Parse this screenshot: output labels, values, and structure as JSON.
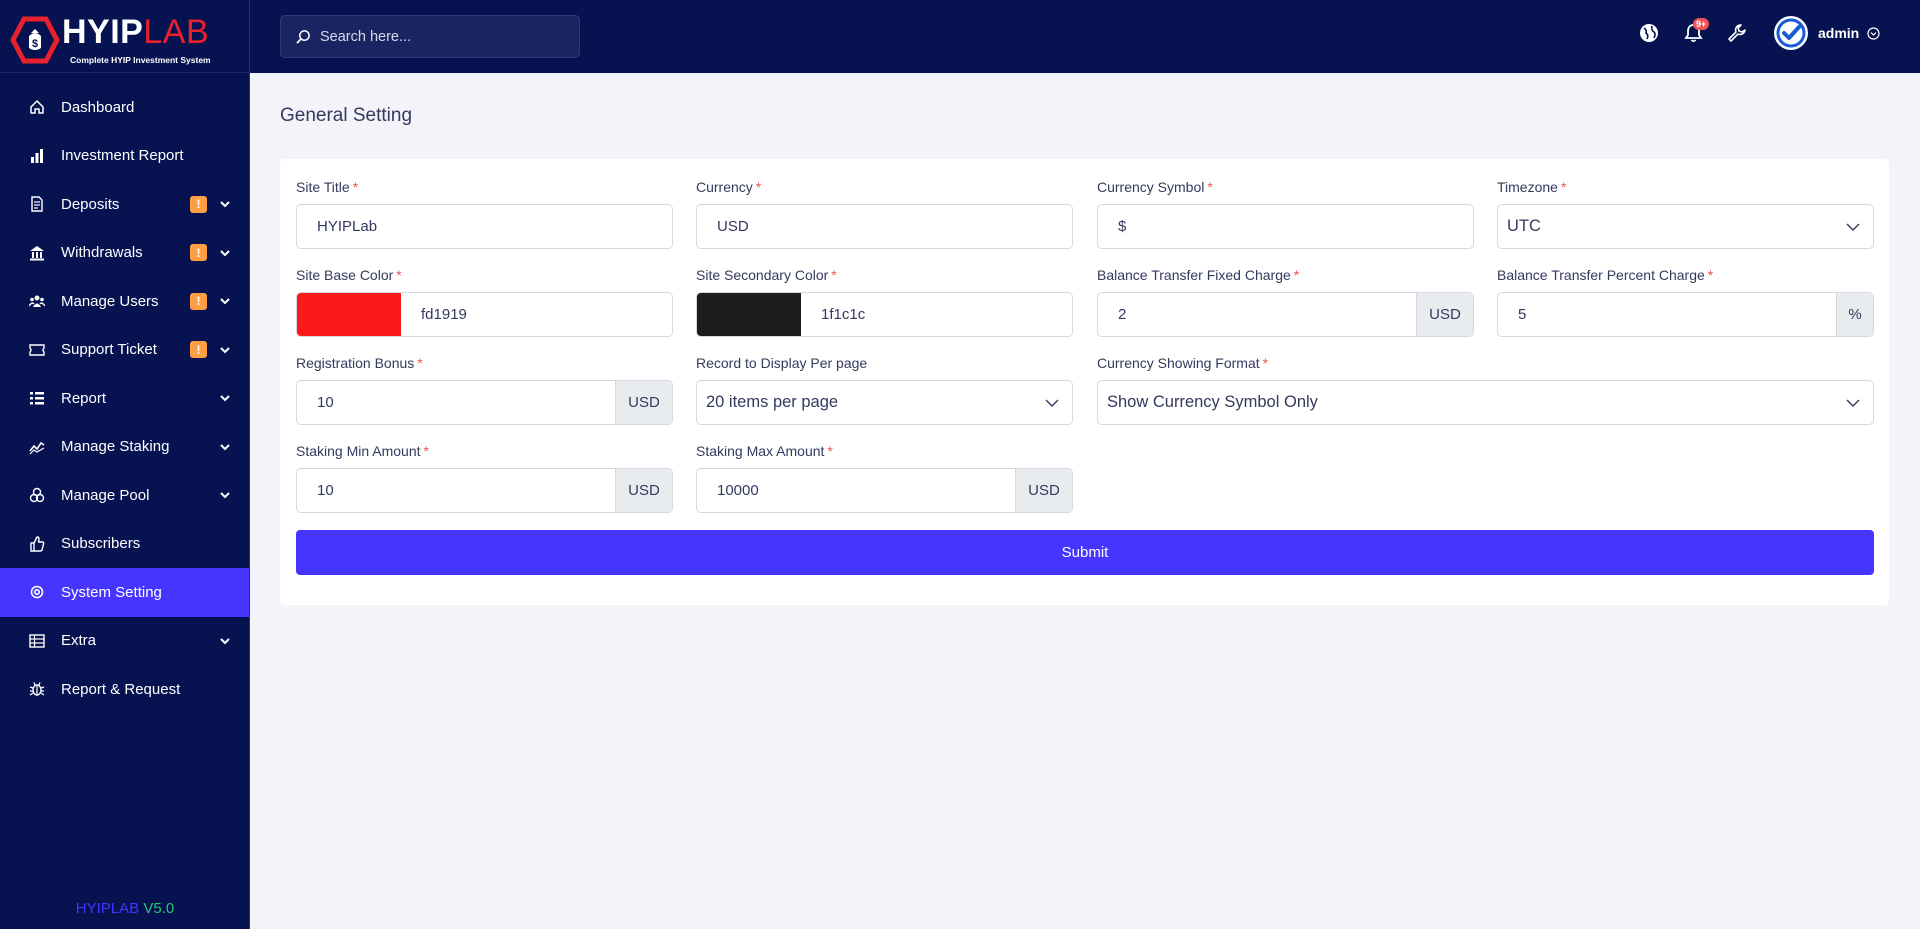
{
  "brand": {
    "name_part1": "HYIP",
    "name_part2": "LAB",
    "tagline": "Complete HYIP Investment System"
  },
  "sidebar": {
    "items": [
      {
        "label": "Dashboard",
        "icon": "home-icon",
        "badge": "",
        "chevron": false,
        "active": false
      },
      {
        "label": "Investment Report",
        "icon": "bar-chart-icon",
        "badge": "",
        "chevron": false,
        "active": false
      },
      {
        "label": "Deposits",
        "icon": "invoice-icon",
        "badge": "!",
        "chevron": true,
        "active": false
      },
      {
        "label": "Withdrawals",
        "icon": "bank-icon",
        "badge": "!",
        "chevron": true,
        "active": false
      },
      {
        "label": "Manage Users",
        "icon": "users-icon",
        "badge": "!",
        "chevron": true,
        "active": false
      },
      {
        "label": "Support Ticket",
        "icon": "ticket-icon",
        "badge": "!",
        "chevron": true,
        "active": false
      },
      {
        "label": "Report",
        "icon": "list-icon",
        "badge": "",
        "chevron": true,
        "active": false
      },
      {
        "label": "Manage Staking",
        "icon": "chart-line-icon",
        "badge": "",
        "chevron": true,
        "active": false
      },
      {
        "label": "Manage Pool",
        "icon": "coins-icon",
        "badge": "",
        "chevron": true,
        "active": false
      },
      {
        "label": "Subscribers",
        "icon": "thumbs-up-icon",
        "badge": "",
        "chevron": false,
        "active": false
      },
      {
        "label": "System Setting",
        "icon": "gear-icon",
        "badge": "",
        "chevron": false,
        "active": true
      },
      {
        "label": "Extra",
        "icon": "table-icon",
        "badge": "",
        "chevron": true,
        "active": false
      },
      {
        "label": "Report & Request",
        "icon": "bug-icon",
        "badge": "",
        "chevron": false,
        "active": false
      }
    ],
    "version_name": "HYIPLAB",
    "version_number": "V5.0"
  },
  "topbar": {
    "search_placeholder": "Search here...",
    "notification_count": "9+",
    "user_name": "admin"
  },
  "page": {
    "title": "General Setting",
    "fields": {
      "site_title": {
        "label": "Site Title",
        "value": "HYIPLab"
      },
      "currency": {
        "label": "Currency",
        "value": "USD"
      },
      "currency_symbol": {
        "label": "Currency Symbol",
        "value": "$"
      },
      "timezone": {
        "label": "Timezone",
        "value": "UTC"
      },
      "base_color": {
        "label": "Site Base Color",
        "value": "fd1919",
        "swatch": "#fd1919"
      },
      "secondary_color": {
        "label": "Site Secondary Color",
        "value": "1f1c1c",
        "swatch": "#1f1c1c"
      },
      "bt_fixed": {
        "label": "Balance Transfer Fixed Charge",
        "value": "2",
        "addon": "USD"
      },
      "bt_percent": {
        "label": "Balance Transfer Percent Charge",
        "value": "5",
        "addon": "%"
      },
      "reg_bonus": {
        "label": "Registration Bonus",
        "value": "10",
        "addon": "USD"
      },
      "per_page": {
        "label": "Record to Display Per page",
        "value": "20 items per page"
      },
      "currency_format": {
        "label": "Currency Showing Format",
        "value": "Show Currency Symbol Only"
      },
      "staking_min": {
        "label": "Staking Min Amount",
        "value": "10",
        "addon": "USD"
      },
      "staking_max": {
        "label": "Staking Max Amount",
        "value": "10000",
        "addon": "USD"
      }
    },
    "submit_label": "Submit"
  }
}
